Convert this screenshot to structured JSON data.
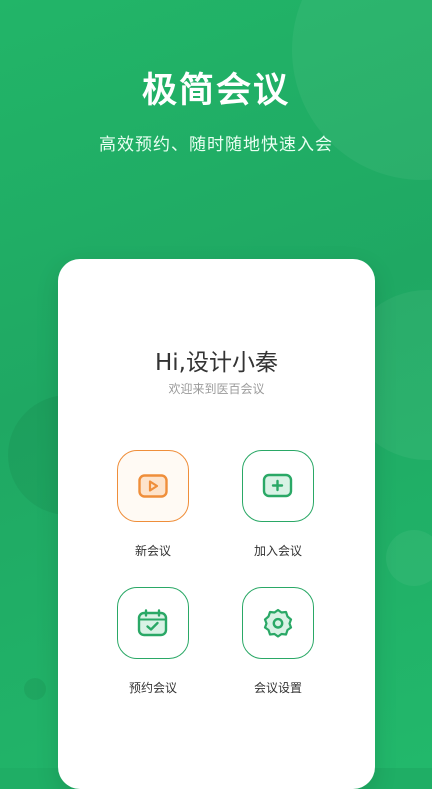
{
  "hero": {
    "title": "极简会议",
    "subtitle": "高效预约、随时随地快速入会"
  },
  "card": {
    "greeting": "Hi,设计小秦",
    "welcome": "欢迎来到医百会议"
  },
  "actions": [
    {
      "label": "新会议",
      "icon": "video-play-icon",
      "accent": "#ef8e3a"
    },
    {
      "label": "加入会议",
      "icon": "plus-box-icon",
      "accent": "#2aa866"
    },
    {
      "label": "预约会议",
      "icon": "calendar-check-icon",
      "accent": "#2aa866"
    },
    {
      "label": "会议设置",
      "icon": "gear-icon",
      "accent": "#2aa866"
    }
  ],
  "colors": {
    "brand_green": "#20ad66",
    "accent_orange": "#ef8e3a",
    "card_bg": "#ffffff"
  }
}
